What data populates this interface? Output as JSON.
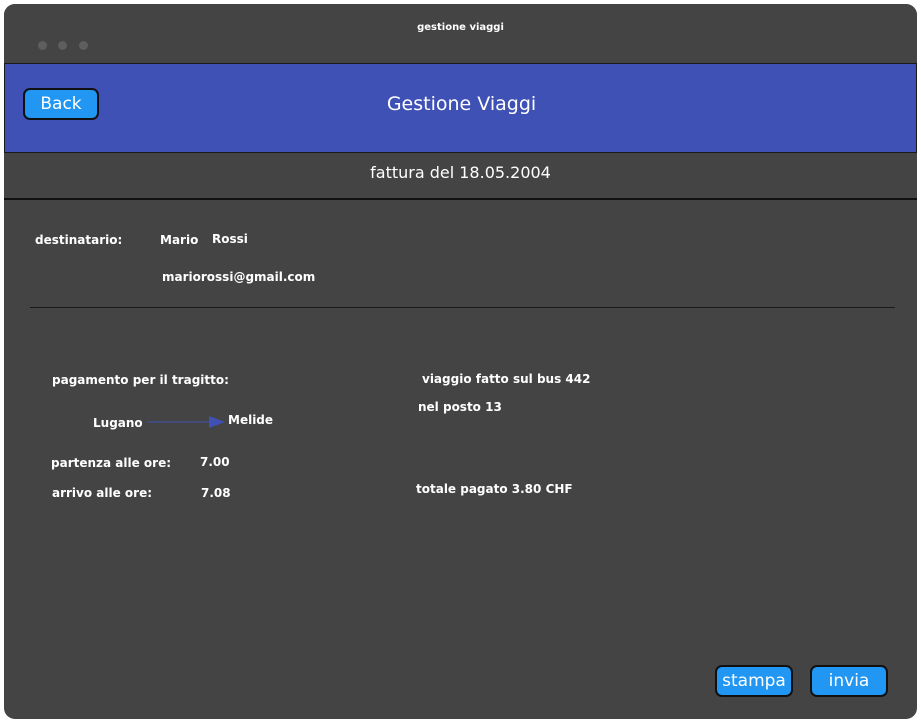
{
  "window": {
    "title": "gestione viaggi"
  },
  "header": {
    "back_label": "Back",
    "title": "Gestione Viaggi"
  },
  "invoice": {
    "title": "fattura del 18.05.2004"
  },
  "recipient": {
    "label": "destinatario:",
    "first_name": "Mario",
    "last_name": "Rossi",
    "email": "mariorossi@gmail.com"
  },
  "trip": {
    "payment_label": "pagamento per il tragitto:",
    "from": "Lugano",
    "to": "Melide",
    "departure_label": "partenza alle ore:",
    "departure_time": "7.00",
    "arrival_label": "arrivo alle ore:",
    "arrival_time": "7.08",
    "bus_text": "viaggio fatto sul bus 442",
    "seat_text": "nel posto 13",
    "total_text": "totale pagato 3.80 CHF"
  },
  "actions": {
    "print_label": "stampa",
    "send_label": "invia"
  },
  "colors": {
    "accent": "#3f51b5",
    "button": "#2196f3",
    "background": "#444444"
  }
}
